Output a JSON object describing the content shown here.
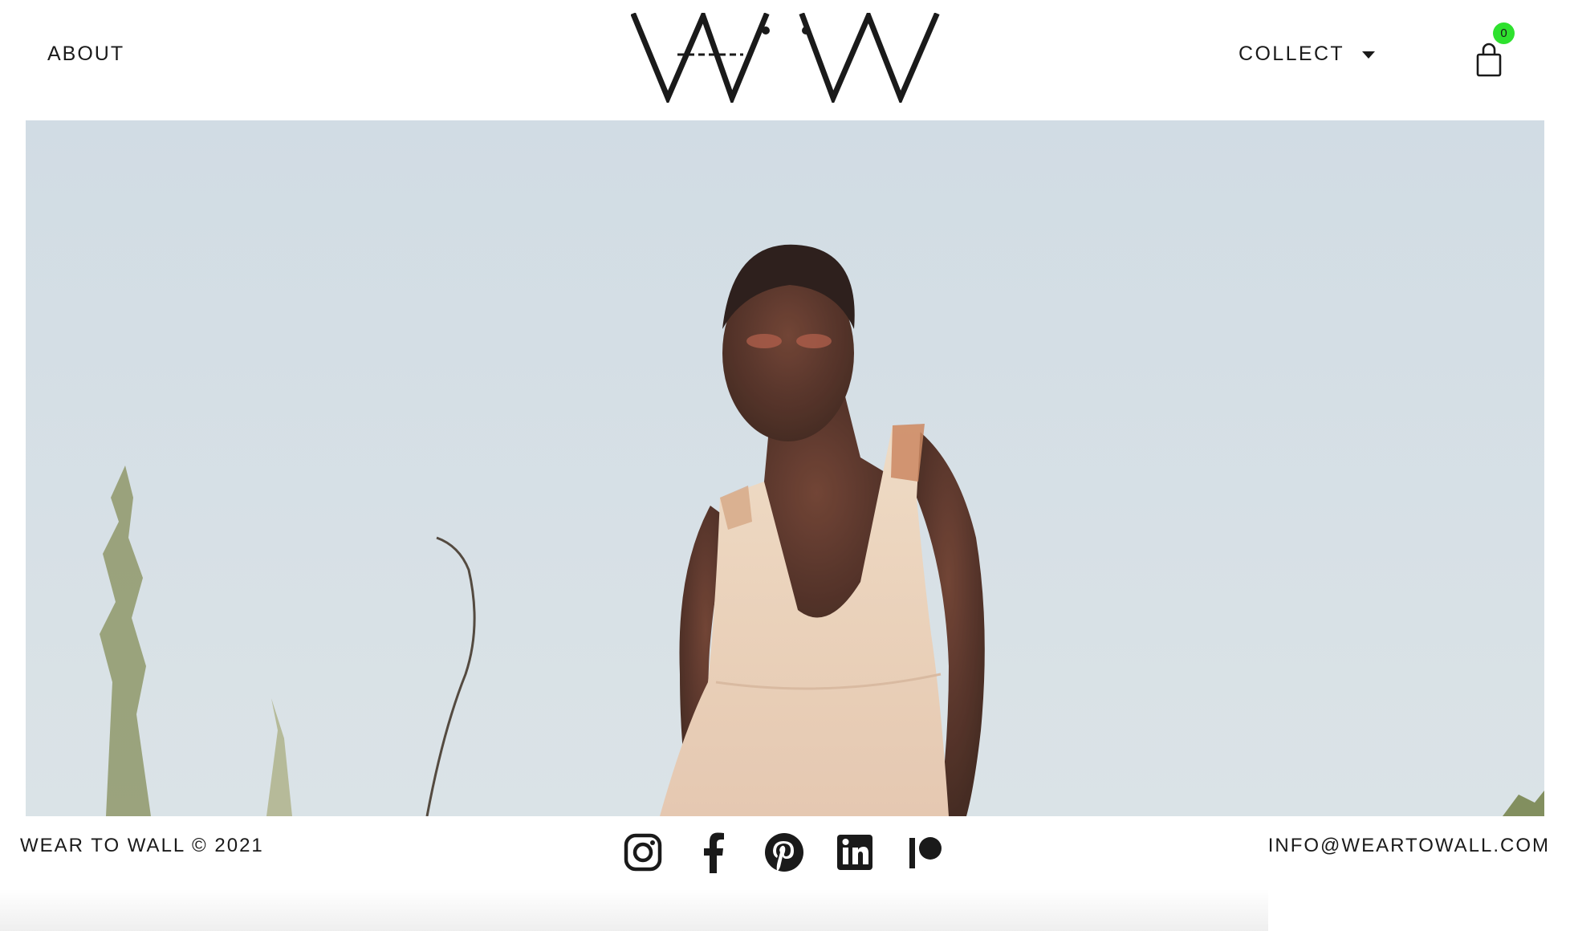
{
  "header": {
    "about_label": "ABOUT",
    "collect_label": "COLLECT",
    "cart_count": "0"
  },
  "brand": {
    "logo_alt": "WTW",
    "badge_color": "#2ee12e"
  },
  "hero": {
    "image_alt": "Woman in a cream sleeveless dress standing against a pale sky"
  },
  "footer": {
    "copyright": "WEAR TO WALL © 2021",
    "email": "INFO@WEARTOWALL.COM",
    "socials": [
      "instagram-icon",
      "facebook-icon",
      "pinterest-icon",
      "linkedin-icon",
      "patreon-icon"
    ]
  }
}
